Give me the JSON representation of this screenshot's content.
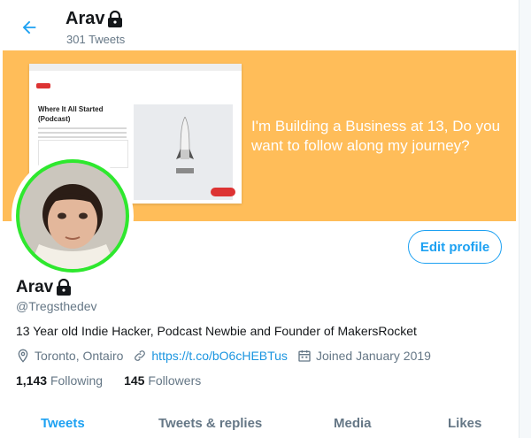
{
  "header": {
    "name": "Arav",
    "tweet_count": "301 Tweets"
  },
  "banner": {
    "text": "I'm Building a Business at 13, Do you want to follow along my journey?",
    "screenshot_title": "Where It All Started (Podcast)",
    "background_color": "#ffbd59"
  },
  "profile": {
    "edit_label": "Edit profile",
    "name": "Arav",
    "handle": "@Tregsthedev",
    "bio": "13 Year old Indie Hacker, Podcast Newbie and Founder of MakersRocket",
    "location": "Toronto, Ontairo",
    "link": "https://t.co/bO6cHEBTus",
    "joined": "Joined January 2019",
    "following_count": "1,143",
    "following_label": "Following",
    "followers_count": "145",
    "followers_label": "Followers",
    "avatar_ring_color": "#2ee82e"
  },
  "tabs": [
    {
      "label": "Tweets",
      "active": true
    },
    {
      "label": "Tweets & replies",
      "active": false
    },
    {
      "label": "Media",
      "active": false
    },
    {
      "label": "Likes",
      "active": false
    }
  ],
  "colors": {
    "accent": "#1da1f2",
    "muted": "#657786"
  },
  "icons": [
    "back-arrow-icon",
    "lock-icon",
    "location-icon",
    "link-icon",
    "calendar-icon"
  ]
}
